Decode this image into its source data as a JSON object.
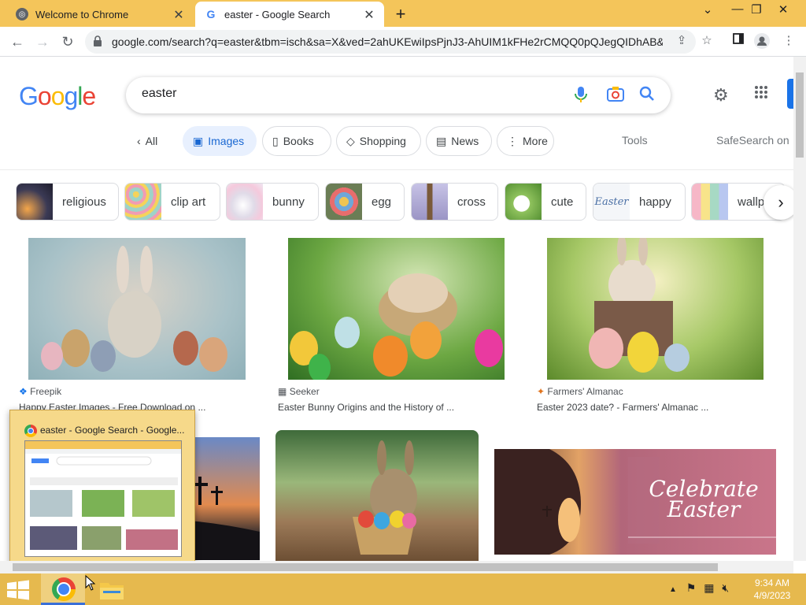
{
  "tabs": [
    {
      "title": "Welcome to Chrome",
      "close": "✕"
    },
    {
      "title": "easter - Google Search",
      "close": "✕"
    }
  ],
  "new_tab": "+",
  "window_controls": {
    "dropdown": "⌄",
    "minimize": "—",
    "restore": "❐",
    "close": "✕"
  },
  "toolbar": {
    "url": "google.com/search?q=easter&tbm=isch&sa=X&ved=2ahUKEwiIpsPjnJ3-AhUIM1kFHe2rCMQQ0pQJegQIDhAB&...",
    "back": "←",
    "forward": "→",
    "reload": "↻"
  },
  "search": {
    "query": "easter"
  },
  "logo": [
    "G",
    "o",
    "o",
    "g",
    "l",
    "e"
  ],
  "logo_colors": [
    "#4285f4",
    "#ea4335",
    "#fbbc05",
    "#4285f4",
    "#34a853",
    "#ea4335"
  ],
  "filters": {
    "all": "All",
    "images": "Images",
    "books": "Books",
    "shopping": "Shopping",
    "news": "News",
    "more": "More",
    "tools": "Tools",
    "safesearch": "SafeSearch on"
  },
  "related": [
    {
      "label": "religious",
      "color": "#2b2a3a"
    },
    {
      "label": "clip art",
      "color": "#cfe3d6"
    },
    {
      "label": "bunny",
      "color": "#e8e1ec"
    },
    {
      "label": "egg",
      "color": "#7a8f6a"
    },
    {
      "label": "cross",
      "color": "#a6a2c8"
    },
    {
      "label": "cute",
      "color": "#8cb85c"
    },
    {
      "label": "happy",
      "color": "#eef2f6"
    },
    {
      "label": "wallp",
      "color": "#f4e6c4"
    }
  ],
  "results": [
    {
      "source": "Freepik",
      "title": "Happy Easter Images - Free Download on ..."
    },
    {
      "source": "Seeker",
      "title": "Easter Bunny Origins and the History of ..."
    },
    {
      "source": "Farmers' Almanac",
      "title": "Easter 2023 date? - Farmers' Almanac ..."
    },
    {
      "source": "",
      "title": ""
    },
    {
      "source": "",
      "title": ""
    },
    {
      "source": "",
      "title": "",
      "overlay": "Celebrate Easter"
    }
  ],
  "preview": {
    "title": "easter - Google Search - Google..."
  },
  "taskbar": {
    "time": "9:34 AM",
    "date": "4/9/2023"
  },
  "accent": "#1a73e8",
  "titlebar_color": "#f4c55a",
  "taskbar_color": "#e6b94e"
}
